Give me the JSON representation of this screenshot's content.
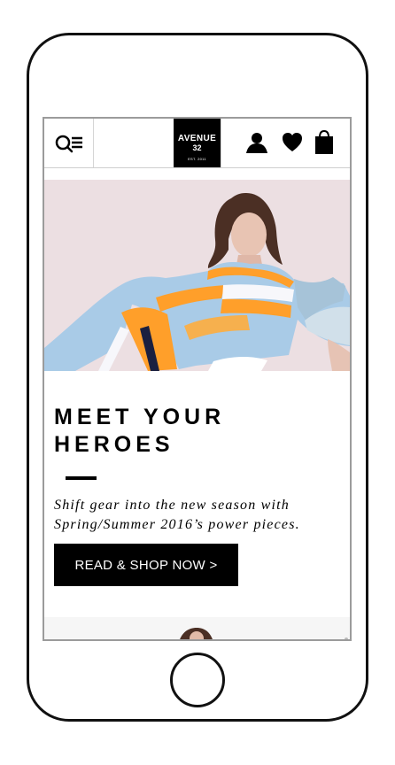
{
  "header": {
    "logo": {
      "line1": "AVENUE",
      "line2": "32",
      "line3": "EST. 2011"
    },
    "icons": {
      "search": "search-icon",
      "menu": "menu-icon",
      "account": "user-icon",
      "wishlist": "heart-icon",
      "bag": "shopping-bag-icon"
    }
  },
  "hero": {
    "image": "model-in-blue-orange-striped-dress"
  },
  "content": {
    "headline": "MEET YOUR HEROES",
    "tagline": "Shift gear into the new season with Spring/Summer 2016’s power pieces.",
    "cta_label": "READ & SHOP NOW >"
  },
  "colors": {
    "accent": "#000000",
    "hero_background": "#ecdfe2",
    "dress_blue": "#a9cbe7",
    "dress_orange": "#ff9f2a"
  }
}
